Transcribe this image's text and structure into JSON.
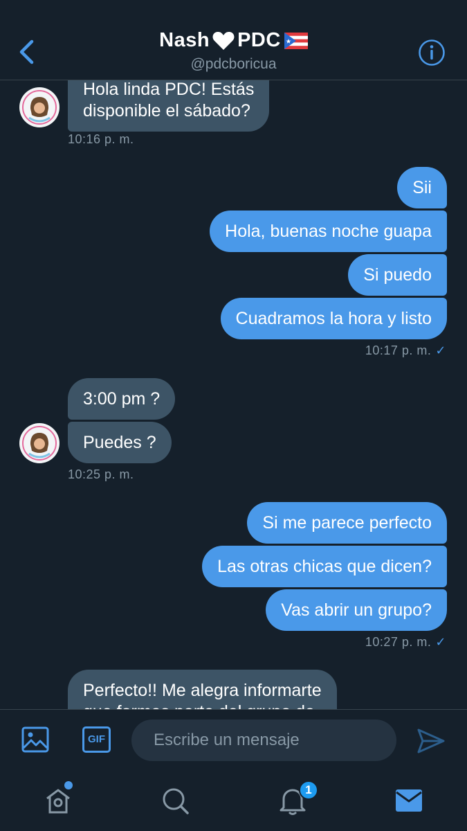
{
  "header": {
    "title_left": "Nash",
    "title_right": "PDC",
    "handle": "@pdcboricua"
  },
  "messages": [
    {
      "side": "received",
      "text_line1": "Hola linda PDC! Estás",
      "text_line2": "disponible el sábado?"
    },
    {
      "side": "received",
      "time": "10:16 p. m."
    },
    {
      "side": "sent",
      "text": "Sii"
    },
    {
      "side": "sent",
      "text": "Hola, buenas noche guapa"
    },
    {
      "side": "sent",
      "text": "Si puedo"
    },
    {
      "side": "sent",
      "text": "Cuadramos la hora y listo"
    },
    {
      "side": "sent",
      "time": "10:17 p. m."
    },
    {
      "side": "received",
      "text": "3:00 pm ?"
    },
    {
      "side": "received",
      "text": "Puedes ?"
    },
    {
      "side": "received",
      "time": "10:25 p. m."
    },
    {
      "side": "sent",
      "text": "Si me parece perfecto"
    },
    {
      "side": "sent",
      "text": "Las otras chicas que dicen?"
    },
    {
      "side": "sent",
      "text": "Vas abrir un grupo?"
    },
    {
      "side": "sent",
      "time": "10:27 p. m."
    },
    {
      "side": "received",
      "text_line1": "Perfecto!! Me alegra informarte",
      "text_line2": "que formas parte del grupo de"
    }
  ],
  "read_check": "✓",
  "composer": {
    "placeholder": "Escribe un mensaje",
    "gif_label": "GIF"
  },
  "tabbar": {
    "notifications_badge": "1"
  },
  "colors": {
    "background": "#15202b",
    "sent_bubble": "#4a99e9",
    "received_bubble": "#3d5466",
    "accent": "#1d9bf0"
  }
}
